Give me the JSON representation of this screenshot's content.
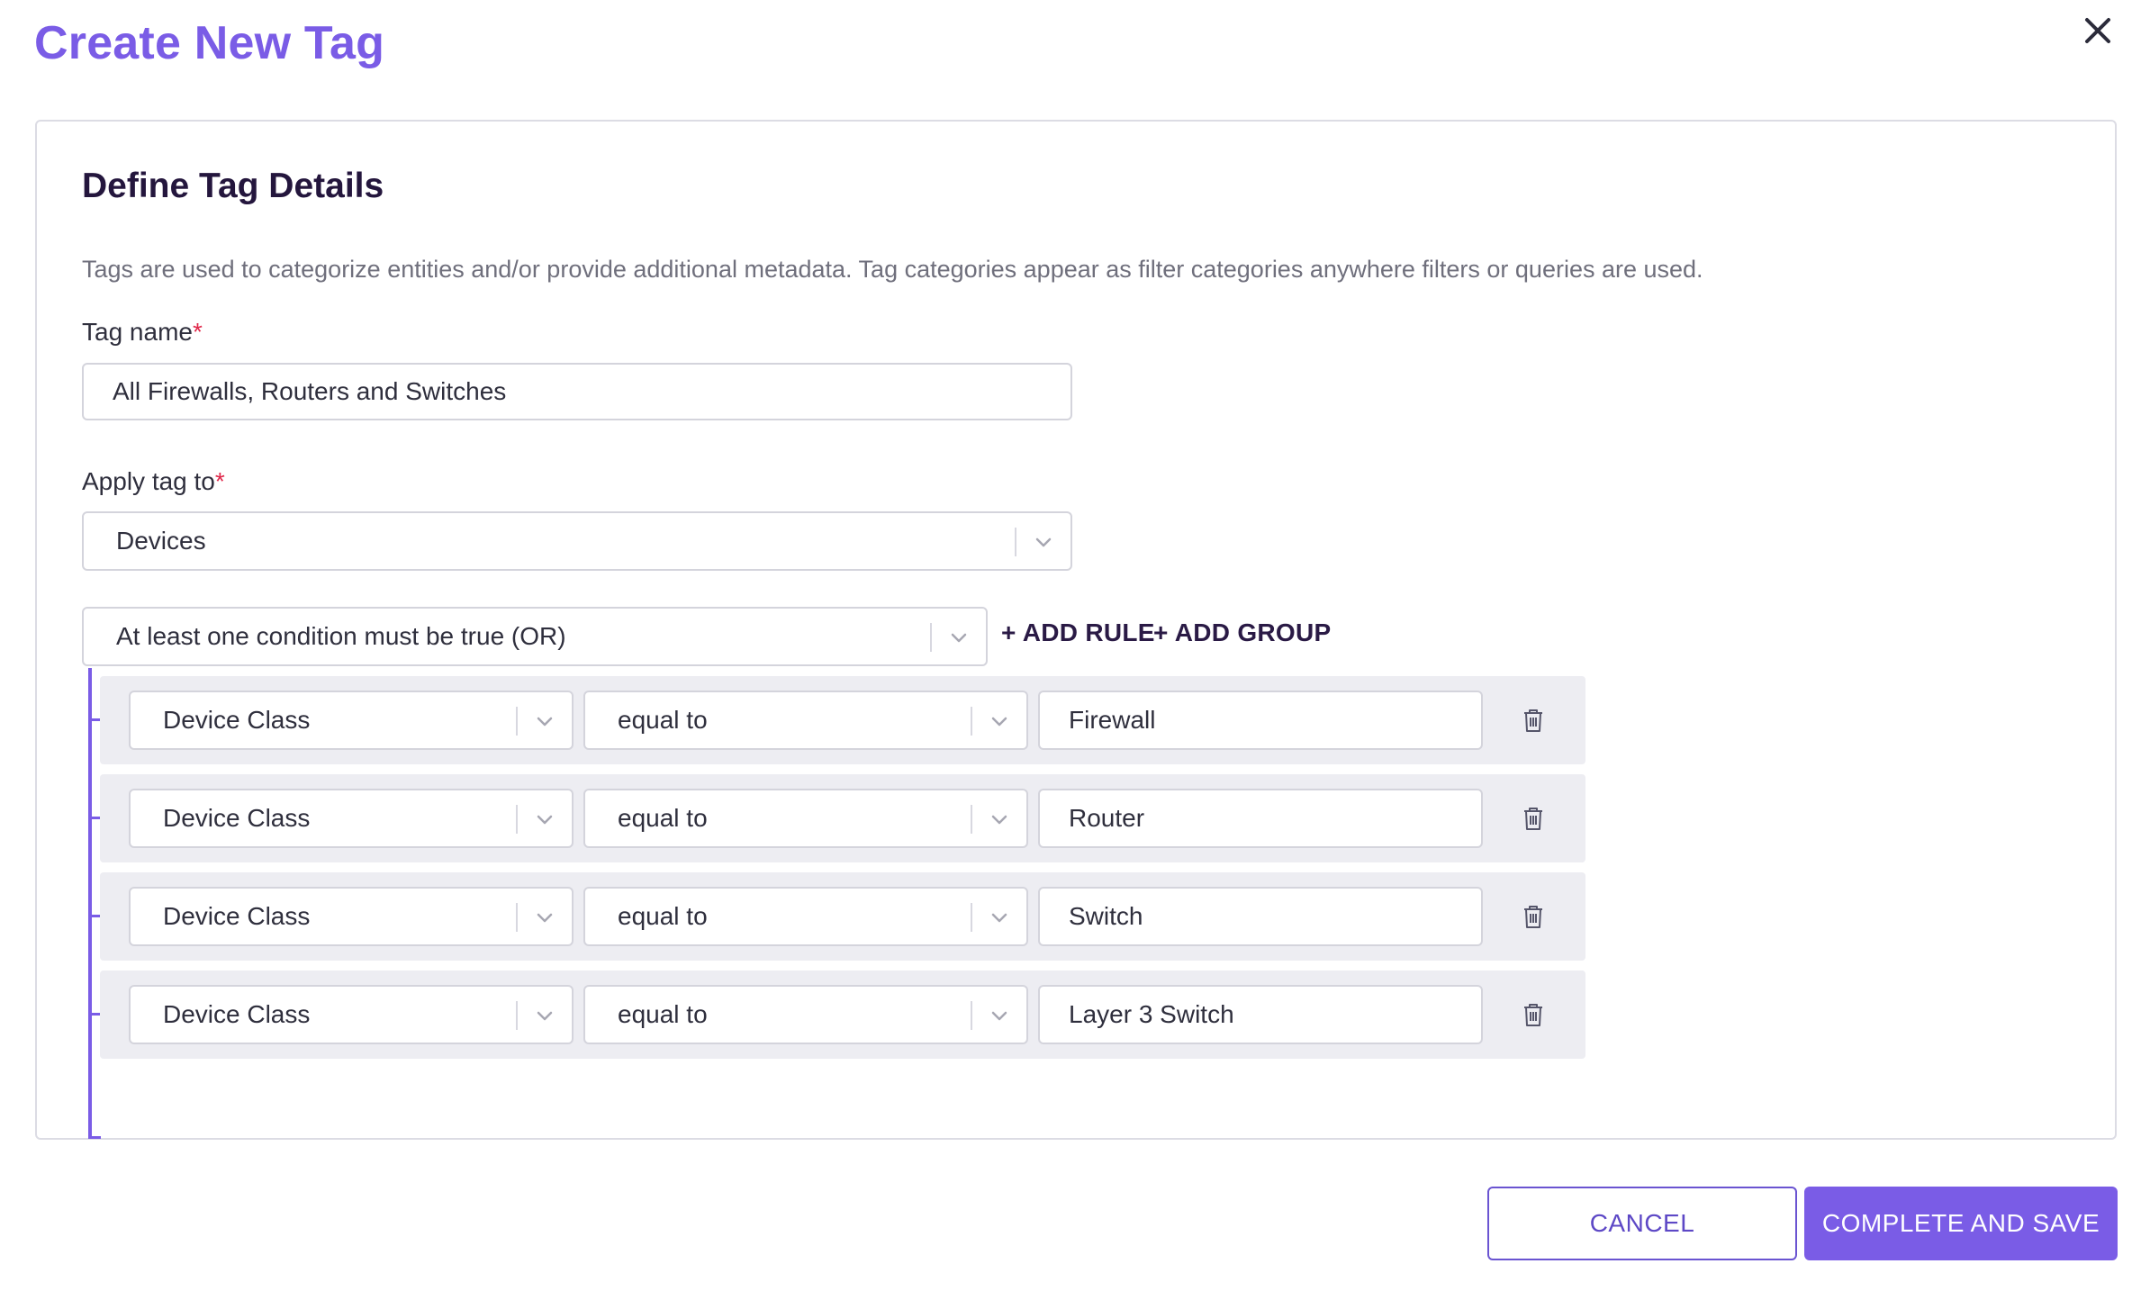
{
  "modal": {
    "title": "Create New Tag",
    "close_icon": "close-icon"
  },
  "section": {
    "title": "Define Tag Details",
    "description": "Tags are used to categorize entities and/or provide additional metadata. Tag categories appear as filter categories anywhere filters or queries are used."
  },
  "tag_name": {
    "label": "Tag name",
    "required_mark": "*",
    "value": "All Firewalls, Routers and Switches"
  },
  "apply_tag_to": {
    "label": "Apply tag to",
    "required_mark": "*",
    "value": "Devices"
  },
  "condition_group": {
    "operator": "At least one condition must be true (OR)",
    "add_rule_label": "+ ADD RULE",
    "add_group_label": "+ ADD GROUP"
  },
  "rules": [
    {
      "field": "Device Class",
      "comparator": "equal to",
      "value": "Firewall"
    },
    {
      "field": "Device Class",
      "comparator": "equal to",
      "value": "Router"
    },
    {
      "field": "Device Class",
      "comparator": "equal to",
      "value": "Switch"
    },
    {
      "field": "Device Class",
      "comparator": "equal to",
      "value": "Layer 3 Switch"
    }
  ],
  "footer": {
    "cancel_label": "CANCEL",
    "save_label": "COMPLETE AND SAVE"
  },
  "colors": {
    "accent": "#7a5ce6",
    "required": "#e0284a",
    "heading": "#24163d",
    "row_bg": "#ededf2"
  },
  "icons": {
    "chevron": "chevron-down-icon",
    "trash": "trash-icon"
  }
}
